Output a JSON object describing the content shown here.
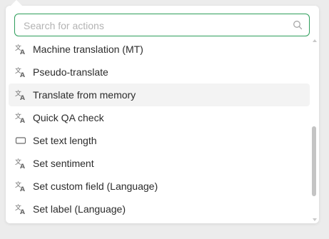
{
  "search": {
    "placeholder": "Search for actions",
    "value": ""
  },
  "actions": [
    {
      "label": "Machine translation (MT)",
      "icon": "translate-icon",
      "highlighted": false
    },
    {
      "label": "Pseudo-translate",
      "icon": "translate-icon",
      "highlighted": false
    },
    {
      "label": "Translate from memory",
      "icon": "translate-icon",
      "highlighted": true
    },
    {
      "label": "Quick QA check",
      "icon": "translate-icon",
      "highlighted": false
    },
    {
      "label": "Set text length",
      "icon": "text-field-icon",
      "highlighted": false
    },
    {
      "label": "Set sentiment",
      "icon": "translate-icon",
      "highlighted": false
    },
    {
      "label": "Set custom field (Language)",
      "icon": "translate-icon",
      "highlighted": false
    },
    {
      "label": "Set label (Language)",
      "icon": "translate-icon",
      "highlighted": false
    }
  ],
  "colors": {
    "search_border": "#2e9e5b",
    "highlight_bg": "#f3f3f3",
    "text": "#2b2b2b",
    "placeholder": "#b3b3b3"
  }
}
